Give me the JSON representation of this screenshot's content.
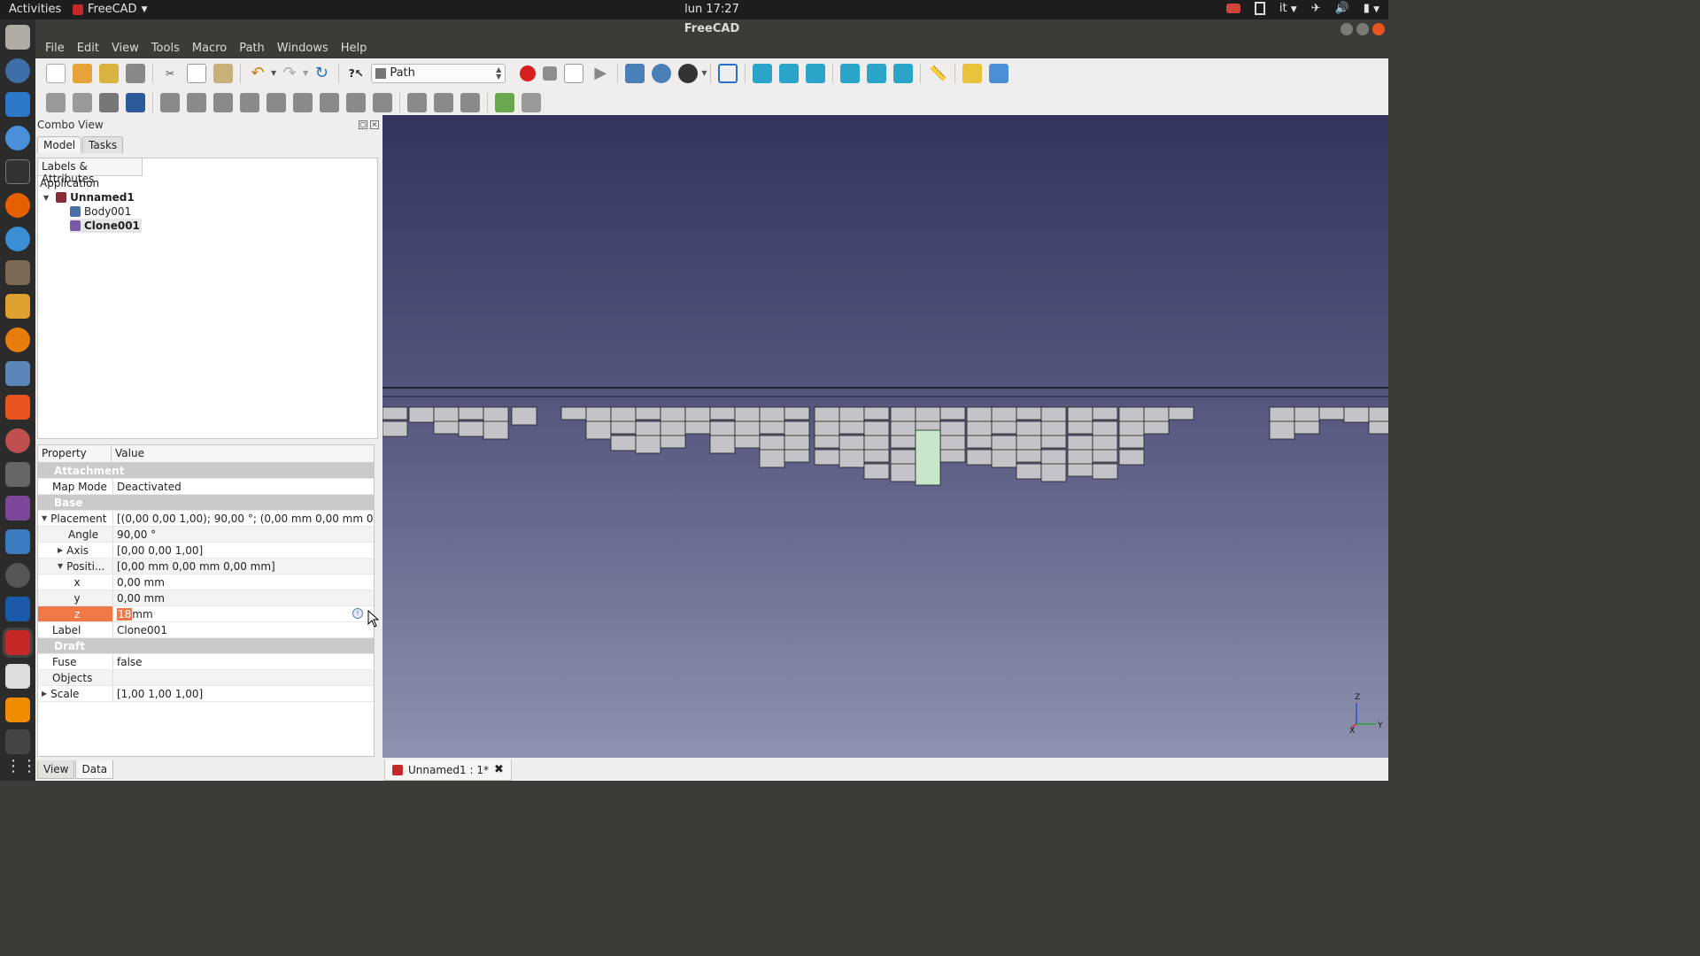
{
  "topbar": {
    "activities": "Activities",
    "app_name": "FreeCAD",
    "clock": "lun 17:27",
    "lang": "it"
  },
  "window": {
    "title": "FreeCAD"
  },
  "menu": [
    "File",
    "Edit",
    "View",
    "Tools",
    "Macro",
    "Path",
    "Windows",
    "Help"
  ],
  "toolbar": {
    "workbench": "Path"
  },
  "combo": {
    "title": "Combo View",
    "tabs": [
      "Model",
      "Tasks"
    ],
    "tree_header": "Labels & Attributes",
    "tree": {
      "root": "Application",
      "doc": "Unnamed1",
      "items": [
        "Body001",
        "Clone001"
      ]
    },
    "props_header": {
      "property": "Property",
      "value": "Value"
    },
    "props": {
      "attachment": "Attachment",
      "map_mode": {
        "name": "Map Mode",
        "value": "Deactivated"
      },
      "base": "Base",
      "placement": {
        "name": "Placement",
        "value": "[(0,00 0,00 1,00); 90,00 °; (0,00 mm  0,00 mm  0,00 m..."
      },
      "angle": {
        "name": "Angle",
        "value": "90,00 °"
      },
      "axis": {
        "name": "Axis",
        "value": "[0,00 0,00 1,00]"
      },
      "position": {
        "name": "Positi...",
        "value": "[0,00 mm  0,00 mm  0,00 mm]"
      },
      "x": {
        "name": "x",
        "value": "0,00 mm"
      },
      "y": {
        "name": "y",
        "value": "0,00 mm"
      },
      "z": {
        "name": "z",
        "value_sel": "18",
        "value_unit": " mm"
      },
      "label": {
        "name": "Label",
        "value": "Clone001"
      },
      "draft": "Draft",
      "fuse": {
        "name": "Fuse",
        "value": "false"
      },
      "objects": {
        "name": "Objects",
        "value": ""
      },
      "scale": {
        "name": "Scale",
        "value": "[1,00 1,00 1,00]"
      }
    },
    "bottom_tabs": [
      "View",
      "Data"
    ]
  },
  "doctab": {
    "label": "Unnamed1 : 1*"
  },
  "axis_labels": {
    "z": "Z",
    "x": "X",
    "y": "Y"
  },
  "colors": {
    "accent": "#f07746",
    "ubuntu_orange": "#e95420",
    "highlight_green": "#c8e6c9"
  }
}
